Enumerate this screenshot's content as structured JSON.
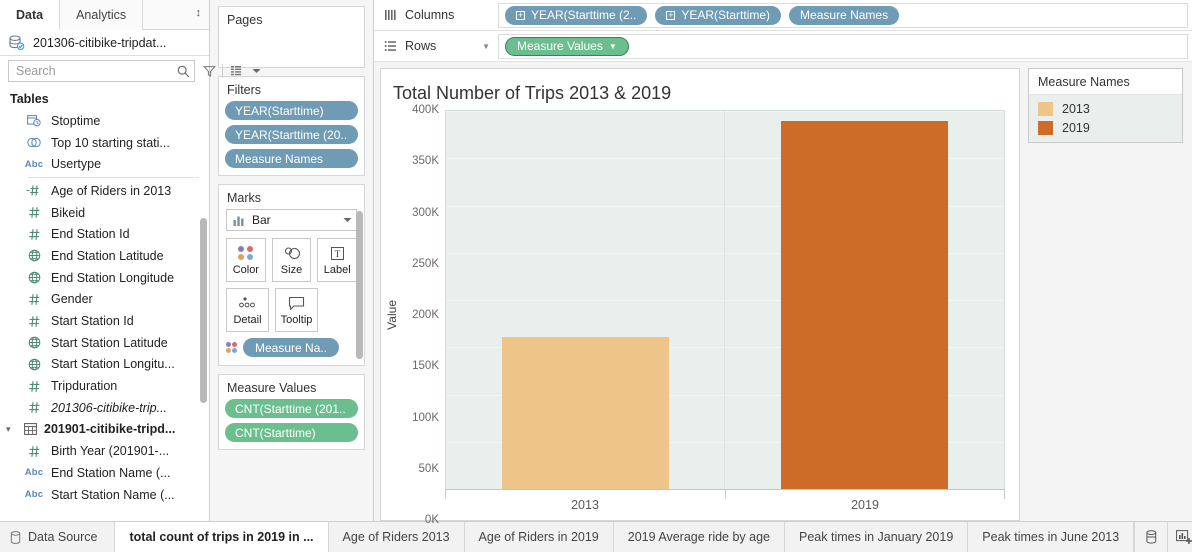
{
  "data_pane": {
    "tabs": [
      {
        "label": "Data",
        "active": true
      },
      {
        "label": "Analytics",
        "active": false
      }
    ],
    "sort_icon": "sort-updown-icon",
    "datasource": {
      "name": "201306-citibike-tripdat...",
      "icon": "datasource-icon"
    },
    "search": {
      "placeholder": "Search",
      "value": "",
      "icon": "search-icon"
    },
    "toolbar_icons": [
      "filter-icon",
      "group-by-table-icon",
      "chevron-down-icon"
    ],
    "tables_header": "Tables",
    "fields": [
      {
        "label": "Stoptime",
        "icon": "date-time-icon",
        "type": "date",
        "indent": 1
      },
      {
        "label": "Top 10 starting stati...",
        "icon": "set-icon",
        "type": "set",
        "indent": 1
      },
      {
        "label": "Usertype",
        "icon": "abc-icon",
        "type": "string",
        "indent": 1
      },
      {
        "separator": true
      },
      {
        "label": "Age of Riders in 2013",
        "icon": "calculated-number-icon",
        "type": "number",
        "indent": 1
      },
      {
        "label": "Bikeid",
        "icon": "number-icon",
        "type": "number",
        "indent": 1
      },
      {
        "label": "End Station Id",
        "icon": "number-icon",
        "type": "number",
        "indent": 1
      },
      {
        "label": "End Station Latitude",
        "icon": "geo-icon",
        "type": "geo",
        "indent": 1
      },
      {
        "label": "End Station Longitude",
        "icon": "geo-icon",
        "type": "geo",
        "indent": 1
      },
      {
        "label": "Gender",
        "icon": "number-icon",
        "type": "number",
        "indent": 1
      },
      {
        "label": "Start Station Id",
        "icon": "number-icon",
        "type": "number",
        "indent": 1
      },
      {
        "label": "Start Station Latitude",
        "icon": "geo-icon",
        "type": "geo",
        "indent": 1
      },
      {
        "label": "Start Station Longitu...",
        "icon": "geo-icon",
        "type": "geo",
        "indent": 1
      },
      {
        "label": "Tripduration",
        "icon": "number-icon",
        "type": "number",
        "indent": 1
      },
      {
        "label": "201306-citibike-trip...",
        "icon": "number-icon",
        "type": "number",
        "indent": 1,
        "italic": true
      },
      {
        "label": "201901-citibike-tripd...",
        "icon": "table-icon",
        "type": "table",
        "indent": 0,
        "bold": true,
        "caret": "⌄"
      },
      {
        "label": "Birth Year (201901-...",
        "icon": "number-icon",
        "type": "number",
        "indent": 1
      },
      {
        "label": "End Station Name (...",
        "icon": "abc-icon",
        "type": "string",
        "indent": 1
      },
      {
        "label": "Start Station Name (...",
        "icon": "abc-icon",
        "type": "string",
        "indent": 1
      }
    ]
  },
  "shelves": {
    "pages": {
      "title": "Pages",
      "pills": []
    },
    "filters": {
      "title": "Filters",
      "pills": [
        {
          "label": "YEAR(Starttime)",
          "color": "blue"
        },
        {
          "label": "YEAR(Starttime (20..",
          "color": "blue"
        },
        {
          "label": "Measure Names",
          "color": "blue"
        }
      ]
    },
    "marks": {
      "title": "Marks",
      "mark_type": {
        "label": "Bar",
        "icon": "bar-mark-icon",
        "dropdown_icon": "chevron-down-icon"
      },
      "buttons": [
        {
          "label": "Color",
          "icon": "color-dots-icon"
        },
        {
          "label": "Size",
          "icon": "size-icon"
        },
        {
          "label": "Label",
          "icon": "label-text-icon"
        },
        {
          "label": "Detail",
          "icon": "detail-dots-icon"
        },
        {
          "label": "Tooltip",
          "icon": "tooltip-icon"
        }
      ],
      "pills": [
        {
          "label": "Measure Na..",
          "color": "blue",
          "icon": "color-dots-icon"
        }
      ]
    },
    "measure_values": {
      "title": "Measure Values",
      "pills": [
        {
          "label": "CNT(Starttime (201..",
          "color": "green"
        },
        {
          "label": "CNT(Starttime)",
          "color": "green"
        }
      ]
    }
  },
  "columns_shelf": {
    "label": "Columns",
    "icon": "columns-icon",
    "pills": [
      {
        "label": "YEAR(Starttime (2..",
        "color": "blue",
        "has_plus": true
      },
      {
        "label": "YEAR(Starttime)",
        "color": "blue",
        "has_plus": true
      },
      {
        "label": "Measure Names",
        "color": "blue",
        "has_plus": false
      }
    ]
  },
  "rows_shelf": {
    "label": "Rows",
    "icon": "rows-icon",
    "dropdown_icon": "chevron-down-icon",
    "pills": [
      {
        "label": "Measure Values",
        "color": "green",
        "has_caret": true
      }
    ]
  },
  "chart_data": {
    "type": "bar",
    "title": "Total Number of Trips 2013 & 2019",
    "xlabel": "",
    "ylabel": "Value",
    "categories": [
      "2013",
      "2019"
    ],
    "values": [
      161000,
      389000
    ],
    "ylim": [
      0,
      400000
    ],
    "yticks": [
      0,
      50000,
      100000,
      150000,
      200000,
      250000,
      300000,
      350000,
      400000
    ],
    "ytick_labels": [
      "0K",
      "50K",
      "100K",
      "150K",
      "200K",
      "250K",
      "300K",
      "350K",
      "400K"
    ],
    "colors": [
      "#eec489",
      "#cd6c28"
    ],
    "plot_background": "#e8efec",
    "grid": true,
    "legend": {
      "title": "Measure Names",
      "position": "right",
      "entries": [
        {
          "label": "2013",
          "color": "#eec489"
        },
        {
          "label": "2019",
          "color": "#cd6c28"
        }
      ]
    }
  },
  "tabbar": {
    "data_source": {
      "label": "Data Source",
      "icon": "data-source-icon"
    },
    "sheets": [
      {
        "label": "total count of trips in 2019 in ...",
        "active": true
      },
      {
        "label": "Age of Riders 2013",
        "active": false
      },
      {
        "label": "Age of Riders in 2019",
        "active": false
      },
      {
        "label": "2019 Average ride by age",
        "active": false
      },
      {
        "label": "Peak times in January 2019",
        "active": false
      },
      {
        "label": "Peak times in June 2013",
        "active": false
      }
    ],
    "new_buttons": [
      {
        "icon": "new-data-source-icon"
      },
      {
        "icon": "new-worksheet-icon"
      },
      {
        "icon": "new-dashboard-icon"
      },
      {
        "icon": "new-story-icon"
      }
    ]
  }
}
